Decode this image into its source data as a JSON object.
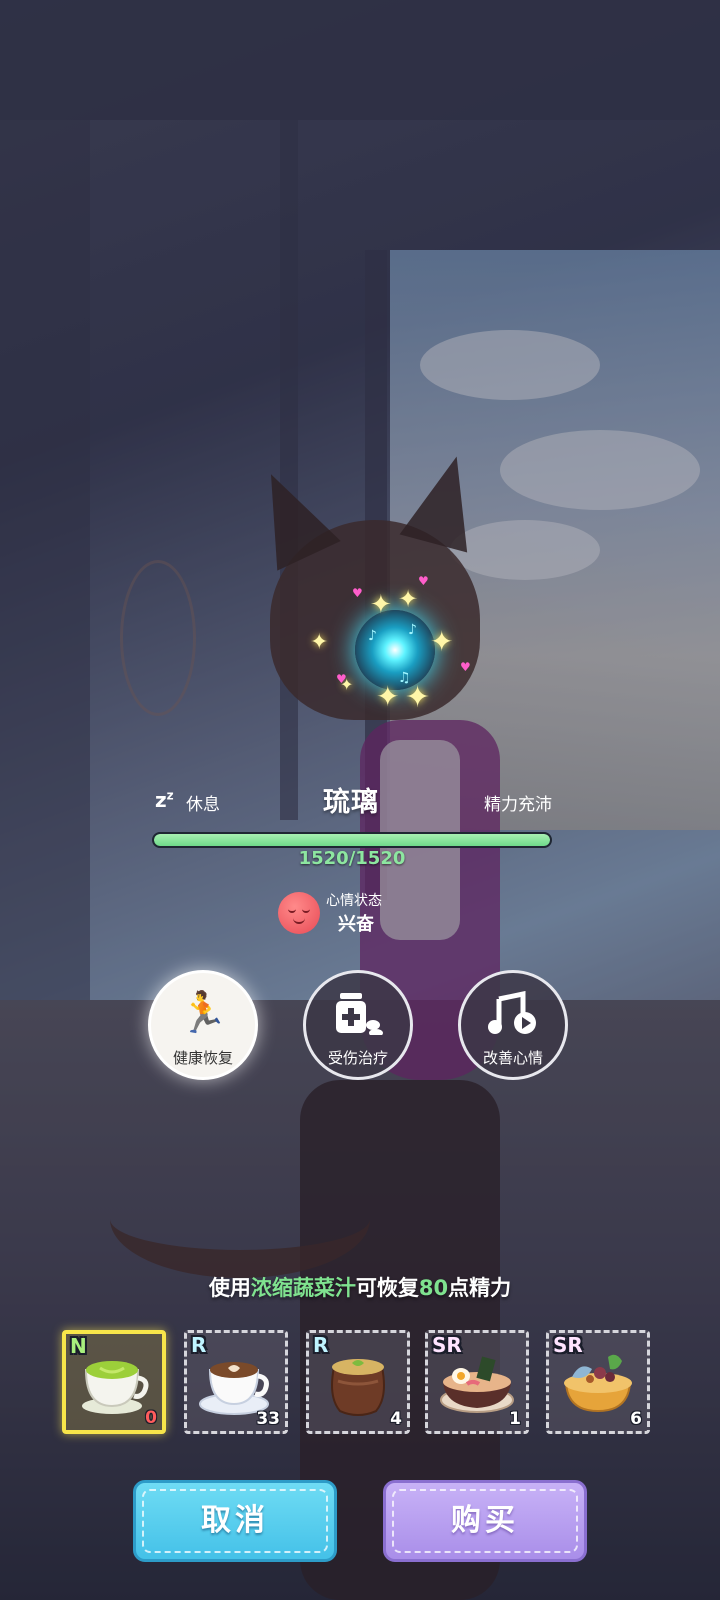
{
  "character": {
    "name": "琉璃",
    "state_left": "休息",
    "state_right": "精力充沛",
    "energy_text": "1520/1520",
    "energy_fraction": 1.0,
    "mood_label": "心情状态",
    "mood_value": "兴奋"
  },
  "actions": [
    {
      "label": "健康恢复",
      "icon": "health-recovery-icon",
      "active": true
    },
    {
      "label": "受伤治疗",
      "icon": "medicine-icon",
      "active": false
    },
    {
      "label": "改善心情",
      "icon": "music-icon",
      "active": false
    }
  ],
  "hint": {
    "prefix": "使用",
    "item_name": "浓缩蔬菜汁",
    "middle": "可恢复",
    "amount": "80",
    "suffix": "点精力"
  },
  "items": [
    {
      "rarity": "N",
      "count": "0",
      "icon": "vegetable-juice-cup-icon",
      "selected": true
    },
    {
      "rarity": "R",
      "count": "33",
      "icon": "latte-cup-icon",
      "selected": false
    },
    {
      "rarity": "R",
      "count": "4",
      "icon": "soup-pot-icon",
      "selected": false
    },
    {
      "rarity": "SR",
      "count": "1",
      "icon": "ramen-bowl-icon",
      "selected": false
    },
    {
      "rarity": "SR",
      "count": "6",
      "icon": "seafood-hotpot-icon",
      "selected": false
    }
  ],
  "buttons": {
    "cancel": "取消",
    "buy": "购买"
  },
  "colors": {
    "energy_bar": "#6fd98a",
    "highlight_text": "#7fe28f",
    "selected_border": "#f7e54a",
    "cancel_button": "#44c1e8",
    "buy_button": "#a98ee9"
  }
}
